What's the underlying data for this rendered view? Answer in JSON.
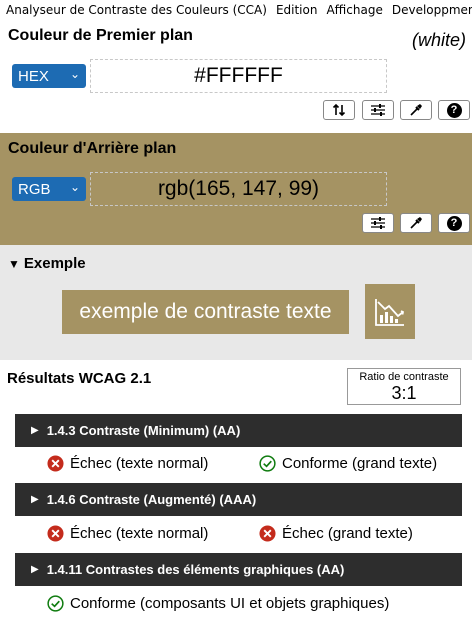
{
  "menubar": {
    "items": [
      "Analyseur de Contraste des Couleurs (CCA)",
      "Edition",
      "Affichage",
      "Developpment"
    ]
  },
  "foreground": {
    "title": "Couleur de Premier plan",
    "color_name": "(white)",
    "format": "HEX",
    "value": "#FFFFFF",
    "color": "#FFFFFF"
  },
  "background": {
    "title": "Couleur d'Arrière plan",
    "format": "RGB",
    "value": "rgb(165, 147, 99)",
    "color": "#A59363"
  },
  "example": {
    "title": "Exemple",
    "sample_text": "exemple de contraste texte"
  },
  "wcag": {
    "title": "Résultats WCAG 2.1",
    "ratio_label": "Ratio de contraste",
    "ratio_value": "3:1",
    "criteria": [
      {
        "label": "1.4.3 Contraste (Minimum) (AA)",
        "results": [
          {
            "status": "fail",
            "text": "Échec (texte normal)"
          },
          {
            "status": "pass",
            "text": "Conforme (grand texte)"
          }
        ]
      },
      {
        "label": "1.4.6 Contraste (Augmenté) (AAA)",
        "results": [
          {
            "status": "fail",
            "text": "Échec (texte normal)"
          },
          {
            "status": "fail",
            "text": "Échec (grand texte)"
          }
        ]
      },
      {
        "label": "1.4.11 Contrastes des éléments graphiques (AA)",
        "results": [
          {
            "status": "pass",
            "text": "Conforme (composants UI et objets graphiques)"
          }
        ]
      }
    ]
  },
  "icons": {
    "swap": "swap-arrows-icon",
    "sliders": "sliders-icon",
    "picker": "eyedropper-icon",
    "help": "help-icon",
    "fail": "fail-x-icon",
    "pass": "pass-check-icon",
    "graph": "contrast-graph-icon"
  },
  "colors": {
    "select_blue": "#1D6BB3",
    "criterion_bg": "#2D2D2D",
    "fail_red": "#C42B1C",
    "pass_green": "#107C10",
    "example_bg": "#E8E8E8"
  }
}
